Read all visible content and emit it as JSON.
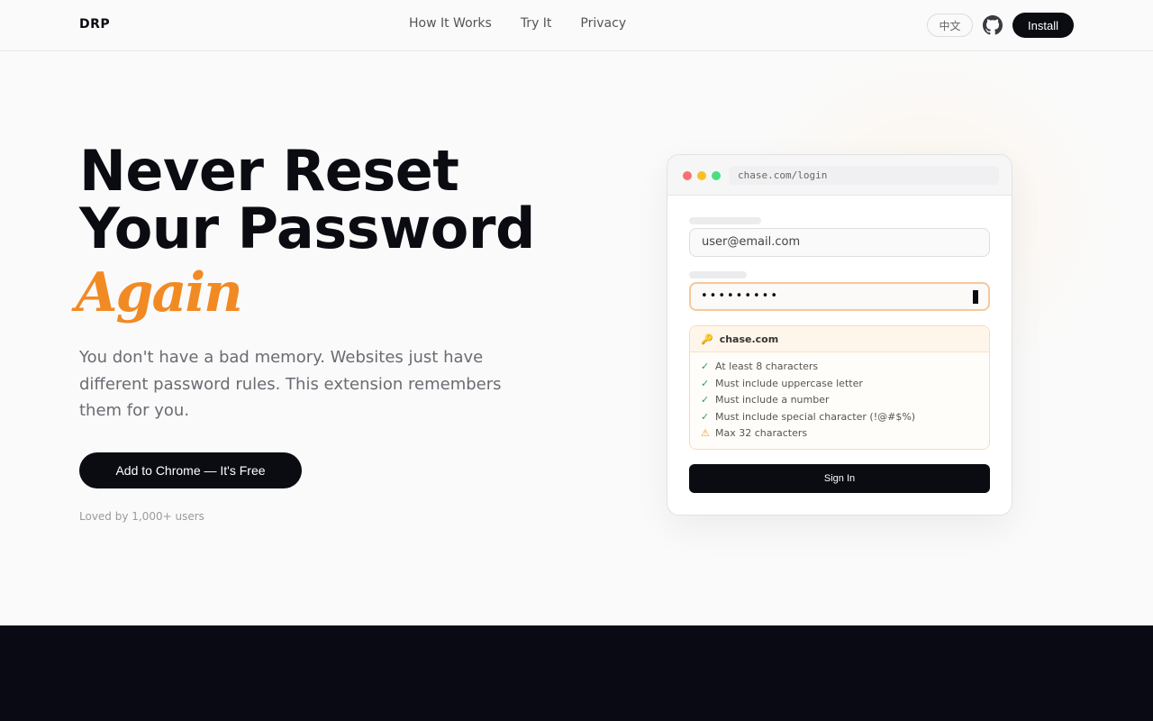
{
  "header": {
    "logo": "DRP",
    "nav": [
      "How It Works",
      "Try It",
      "Privacy"
    ],
    "lang_label": "中文",
    "install_label": "Install"
  },
  "hero": {
    "headline_line1": "Never Reset",
    "headline_line2": "Your Password",
    "headline_accent": "Again",
    "subtext": "You don't have a bad memory. Websites just have different password rules. This extension remembers them for you.",
    "cta_label": "Add to Chrome — It's Free",
    "social_proof": "Loved by 1,000+ users"
  },
  "mockup": {
    "url": "chase.com/login",
    "email_value": "user@email.com",
    "password_value": "•••••••••",
    "rules_site": "chase.com",
    "rules_icon": "🔑",
    "rules": [
      {
        "mark": "✓",
        "status": "ok",
        "text": "At least 8 characters"
      },
      {
        "mark": "✓",
        "status": "ok",
        "text": "Must include uppercase letter"
      },
      {
        "mark": "✓",
        "status": "ok",
        "text": "Must include a number"
      },
      {
        "mark": "✓",
        "status": "ok",
        "text": "Must include special character (!@#$%)"
      },
      {
        "mark": "⚠",
        "status": "warn",
        "text": "Max 32 characters"
      }
    ],
    "signin_label": "Sign In"
  },
  "colors": {
    "accent": "#f28a24",
    "dark": "#0b0b12",
    "ok": "#2e9e5b",
    "warn": "#f29a2e"
  }
}
